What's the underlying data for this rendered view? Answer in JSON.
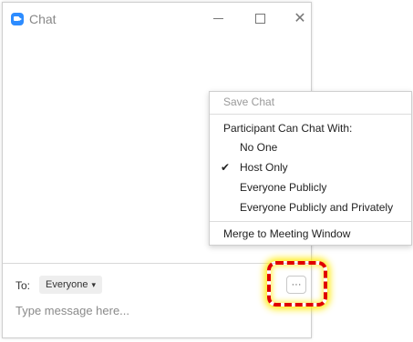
{
  "window": {
    "title": "Chat",
    "minimize_icon": "minimize-icon",
    "maximize_icon": "maximize-icon",
    "close_glyph": "✕"
  },
  "composer": {
    "to_label": "To:",
    "recipient": "Everyone",
    "placeholder": "Type message here...",
    "more_glyph": "···"
  },
  "menu": {
    "save_chat": "Save Chat",
    "header": "Participant Can Chat With:",
    "options": [
      {
        "label": "No One",
        "checked": false
      },
      {
        "label": "Host Only",
        "checked": true
      },
      {
        "label": "Everyone Publicly",
        "checked": false
      },
      {
        "label": "Everyone Publicly and Privately",
        "checked": false
      }
    ],
    "merge": "Merge to Meeting Window",
    "check_glyph": "✔"
  },
  "colors": {
    "brand": "#2d8cff",
    "highlight_border": "#e00000",
    "highlight_glow": "#ffeb00"
  }
}
